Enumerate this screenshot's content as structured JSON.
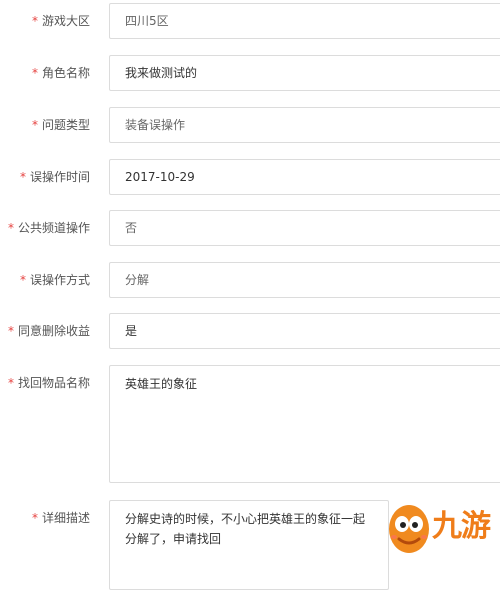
{
  "form": {
    "rows": [
      {
        "label": "游戏大区",
        "value": "四川5区"
      },
      {
        "label": "角色名称",
        "value": "我来做测试的"
      },
      {
        "label": "问题类型",
        "value": "装备误操作"
      },
      {
        "label": "误操作时间",
        "value": "2017-10-29"
      },
      {
        "label": "公共频道操作",
        "value": "否"
      },
      {
        "label": "误操作方式",
        "value": "分解"
      },
      {
        "label": "同意删除收益",
        "value": "是"
      },
      {
        "label": "找回物品名称",
        "value": "英雄王的象征"
      },
      {
        "label": "详细描述",
        "value": "分解史诗的时候，不小心把英雄王的象征一起分解了，申请找回"
      }
    ],
    "required_mark": "*"
  },
  "watermark": {
    "text": "九游",
    "brand_color": "#ef7d1a"
  },
  "colors": {
    "required": "#e64340",
    "border": "#dcdcdc"
  }
}
